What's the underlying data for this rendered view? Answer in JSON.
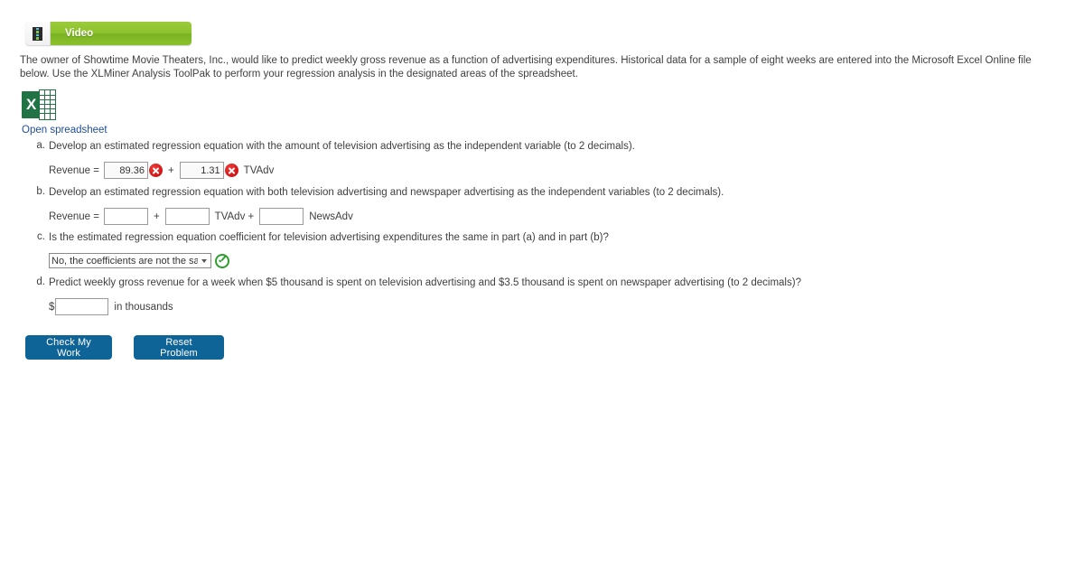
{
  "video_badge": {
    "label": "Video",
    "icon": "film-strip-icon",
    "color": "#8cc22c"
  },
  "intro": {
    "text": "The owner of Showtime Movie Theaters, Inc., would like to predict weekly gross revenue as a function of advertising expenditures. Historical data for a sample of eight weeks are entered into the Microsoft Excel Online file below. Use the XLMiner Analysis ToolPak to perform your regression analysis in the designated areas of the spreadsheet."
  },
  "spreadsheet": {
    "icon": "excel-file-icon",
    "icon_letter": "X",
    "link_label": "Open spreadsheet",
    "link_color": "#1f4e99"
  },
  "parts": {
    "a": {
      "letter": "a.",
      "question": "Develop an estimated regression equation with the amount of television advertising as the independent variable (to 2 decimals).",
      "equation_label": "Revenue =",
      "intercept_value": "89.36",
      "intercept_status": "incorrect",
      "plus": "+",
      "slope_value": "1.31",
      "slope_status": "incorrect",
      "variable": "TVAdv"
    },
    "b": {
      "letter": "b.",
      "question": "Develop an estimated regression equation with both television advertising and newspaper advertising as the independent variables (to 2 decimals).",
      "equation_label": "Revenue =",
      "intercept_value": "",
      "plus1": "+",
      "tv_value": "",
      "tv_variable": "TVAdv +",
      "news_value": "",
      "news_variable": "NewsAdv"
    },
    "c": {
      "letter": "c.",
      "question": "Is the estimated regression equation coefficient for television advertising expenditures the same in part (a) and in part (b)?",
      "selected_option": "No, the coefficients are not the same",
      "status": "correct"
    },
    "d": {
      "letter": "d.",
      "question": "Predict weekly gross revenue for a week when $5 thousand is spent on television advertising and $3.5 thousand is spent on newspaper advertising (to 2 decimals)?",
      "currency_symbol": "$",
      "value": "",
      "suffix": "in thousands"
    }
  },
  "buttons": {
    "check": "Check My Work",
    "reset": "Reset Problem",
    "color": "#0e6397"
  }
}
